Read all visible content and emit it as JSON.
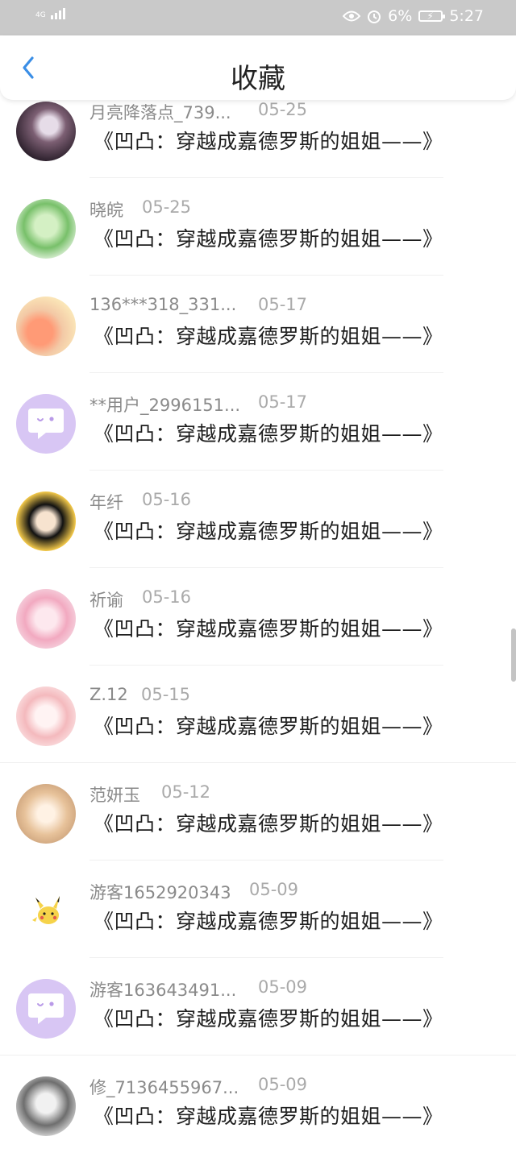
{
  "status_bar": {
    "network_type": "4G",
    "battery_percent": "6%",
    "time": "5:27"
  },
  "header": {
    "title": "收藏"
  },
  "items": [
    {
      "user": "月亮降落点_739...",
      "date": "05-25",
      "title": "《凹凸：穿越成嘉德罗斯的姐姐——》"
    },
    {
      "user": "晓皖",
      "date": "05-25",
      "title": "《凹凸：穿越成嘉德罗斯的姐姐——》"
    },
    {
      "user": "136***318_331...",
      "date": "05-17",
      "title": "《凹凸：穿越成嘉德罗斯的姐姐——》"
    },
    {
      "user": "**用户_2996151...",
      "date": "05-17",
      "title": "《凹凸：穿越成嘉德罗斯的姐姐——》"
    },
    {
      "user": "年纤",
      "date": "05-16",
      "title": "《凹凸：穿越成嘉德罗斯的姐姐——》"
    },
    {
      "user": "祈谕",
      "date": "05-16",
      "title": "《凹凸：穿越成嘉德罗斯的姐姐——》"
    },
    {
      "user": "Z.12",
      "date": "05-15",
      "title": "《凹凸：穿越成嘉德罗斯的姐姐——》"
    },
    {
      "user": "范妍玉",
      "date": "05-12",
      "title": "《凹凸：穿越成嘉德罗斯的姐姐——》"
    },
    {
      "user": "游客1652920343",
      "date": "05-09",
      "title": "《凹凸：穿越成嘉德罗斯的姐姐——》"
    },
    {
      "user": "游客163643491...",
      "date": "05-09",
      "title": "《凹凸：穿越成嘉德罗斯的姐姐——》"
    },
    {
      "user": "修_7136455967...",
      "date": "05-09",
      "title": "《凹凸：穿越成嘉德罗斯的姐姐——》"
    }
  ],
  "colors": {
    "accent": "#3a8ee6",
    "status_bar_bg": "#c9c9c9",
    "placeholder_avatar": "#d8c6f4"
  }
}
